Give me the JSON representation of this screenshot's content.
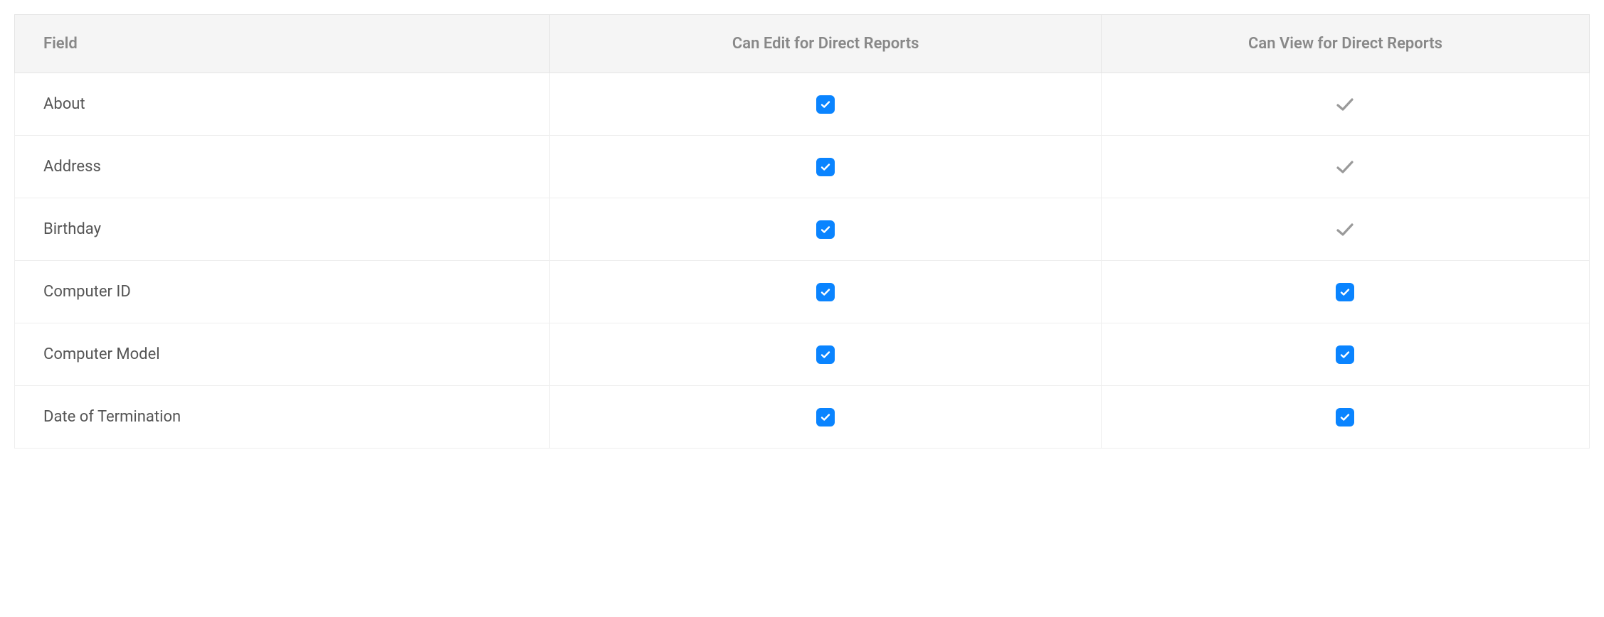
{
  "table": {
    "headers": {
      "field": "Field",
      "can_edit": "Can Edit for Direct Reports",
      "can_view": "Can View for Direct Reports"
    },
    "rows": [
      {
        "field": "About",
        "can_edit": "checkbox",
        "can_view": "check"
      },
      {
        "field": "Address",
        "can_edit": "checkbox",
        "can_view": "check"
      },
      {
        "field": "Birthday",
        "can_edit": "checkbox",
        "can_view": "check"
      },
      {
        "field": "Computer ID",
        "can_edit": "checkbox",
        "can_view": "checkbox"
      },
      {
        "field": "Computer Model",
        "can_edit": "checkbox",
        "can_view": "checkbox"
      },
      {
        "field": "Date of Termination",
        "can_edit": "checkbox",
        "can_view": "checkbox"
      }
    ]
  }
}
